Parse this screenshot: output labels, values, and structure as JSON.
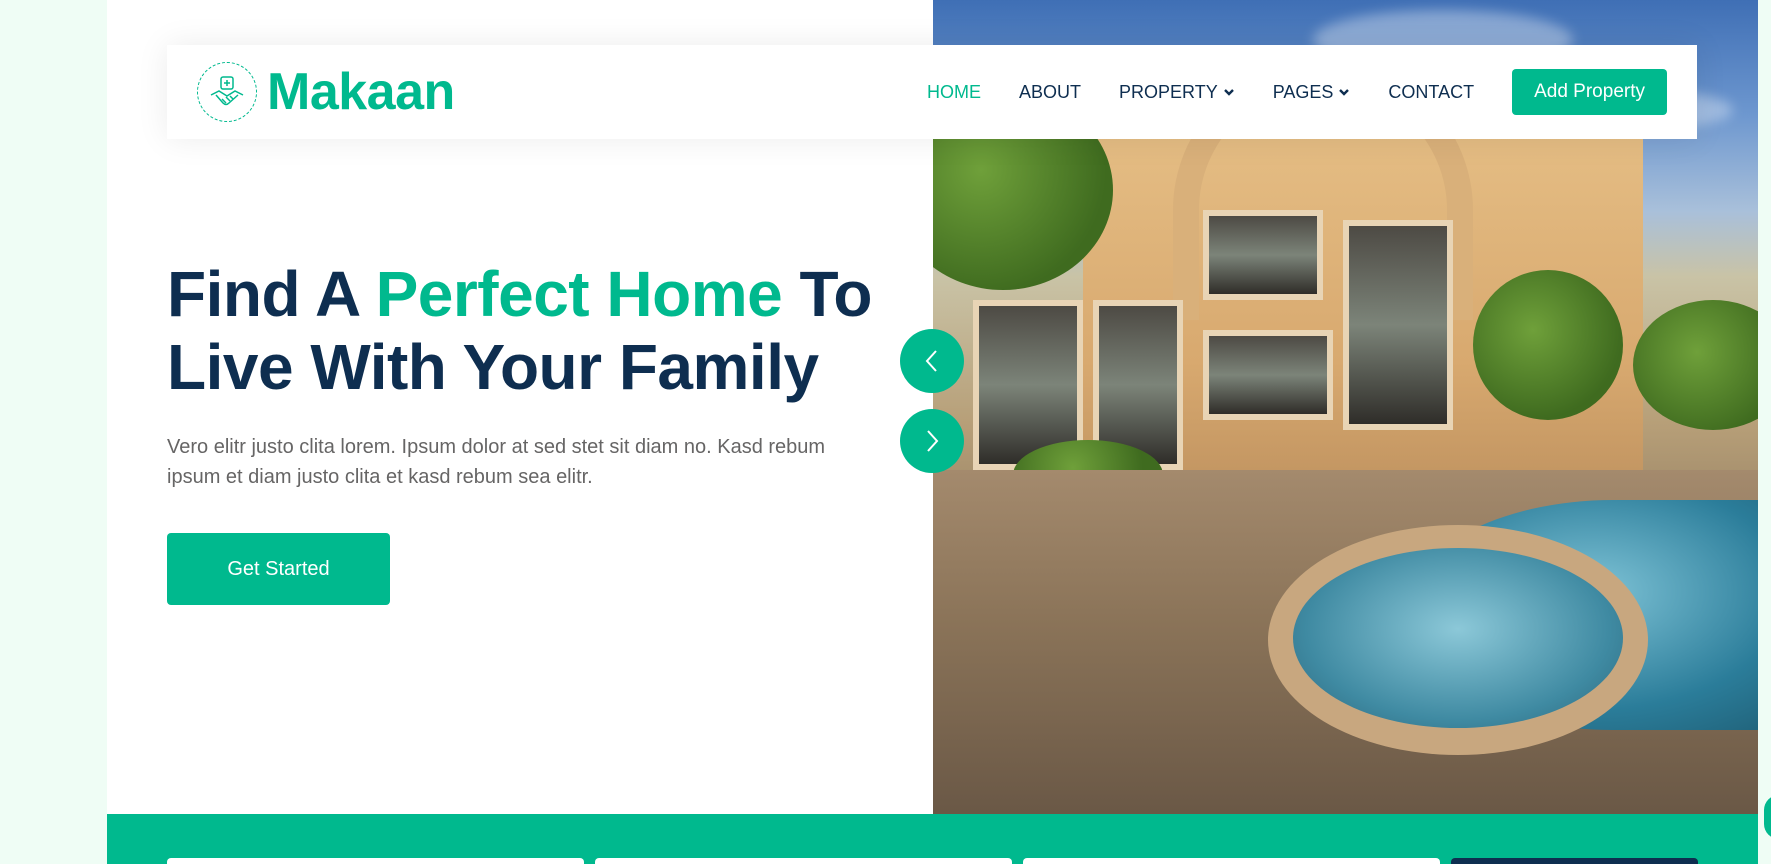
{
  "brand": {
    "name": "Makaan",
    "logo_icon": "handshake-icon"
  },
  "nav": {
    "items": [
      {
        "label": "HOME",
        "active": true
      },
      {
        "label": "ABOUT"
      },
      {
        "label": "PROPERTY",
        "has_dropdown": true
      },
      {
        "label": "PAGES",
        "has_dropdown": true
      },
      {
        "label": "CONTACT"
      }
    ],
    "cta_label": "Add Property"
  },
  "hero": {
    "title_part1": "Find A ",
    "title_accent": "Perfect Home",
    "title_part2": " To Live With Your Family",
    "description": "Vero elitr justo clita lorem. Ipsum dolor at sed stet sit diam no. Kasd rebum ipsum et diam justo clita et kasd rebum sea elitr.",
    "cta_label": "Get Started",
    "carousel_prev_icon": "chevron-left-icon",
    "carousel_next_icon": "chevron-right-icon"
  },
  "colors": {
    "primary": "#00B98E",
    "dark": "#0E2E50",
    "body_text": "#666565",
    "page_bg": "#EFFDF5"
  }
}
